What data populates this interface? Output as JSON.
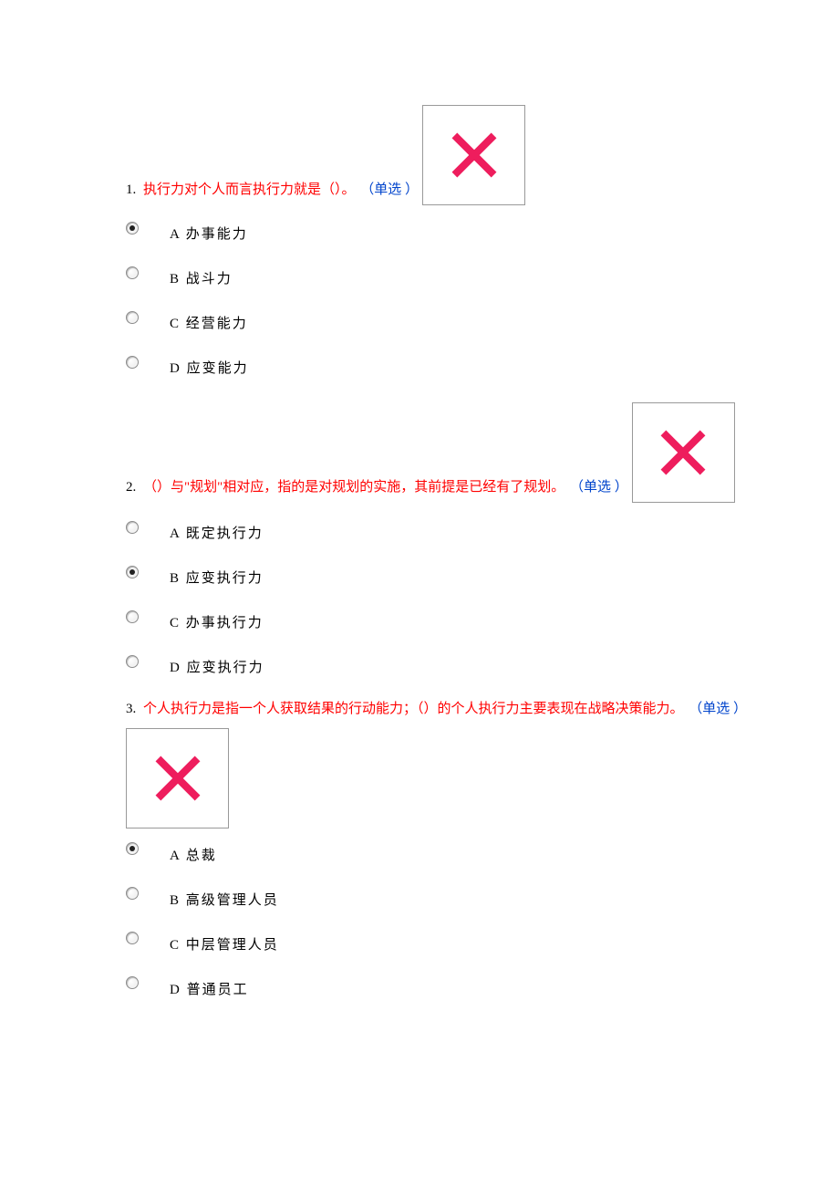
{
  "questions": [
    {
      "number": "1.",
      "text": "执行力对个人而言执行力就是（）。",
      "type_label": "（单选 ）",
      "mark": "wrong",
      "options": [
        {
          "label": "A 办事能力",
          "selected": true
        },
        {
          "label": "B 战斗力",
          "selected": false
        },
        {
          "label": "C 经营能力",
          "selected": false
        },
        {
          "label": "D 应变能力",
          "selected": false
        }
      ]
    },
    {
      "number": "2.",
      "text": "（）与\"规划\"相对应，指的是对规划的实施，其前提是已经有了规划。",
      "type_label": "（单选 ）",
      "mark": "wrong",
      "options": [
        {
          "label": "A 既定执行力",
          "selected": false
        },
        {
          "label": "B 应变执行力",
          "selected": true
        },
        {
          "label": "C 办事执行力",
          "selected": false
        },
        {
          "label": "D 应变执行力",
          "selected": false
        }
      ]
    },
    {
      "number": "3.",
      "text": "个人执行力是指一个人获取结果的行动能力；（）的个人执行力主要表现在战略决策能力。",
      "type_label": "（单选 ）",
      "mark": "wrong",
      "options": [
        {
          "label": "A 总裁",
          "selected": true
        },
        {
          "label": "B 高级管理人员",
          "selected": false
        },
        {
          "label": "C 中层管理人员",
          "selected": false
        },
        {
          "label": "D 普通员工",
          "selected": false
        }
      ]
    }
  ]
}
